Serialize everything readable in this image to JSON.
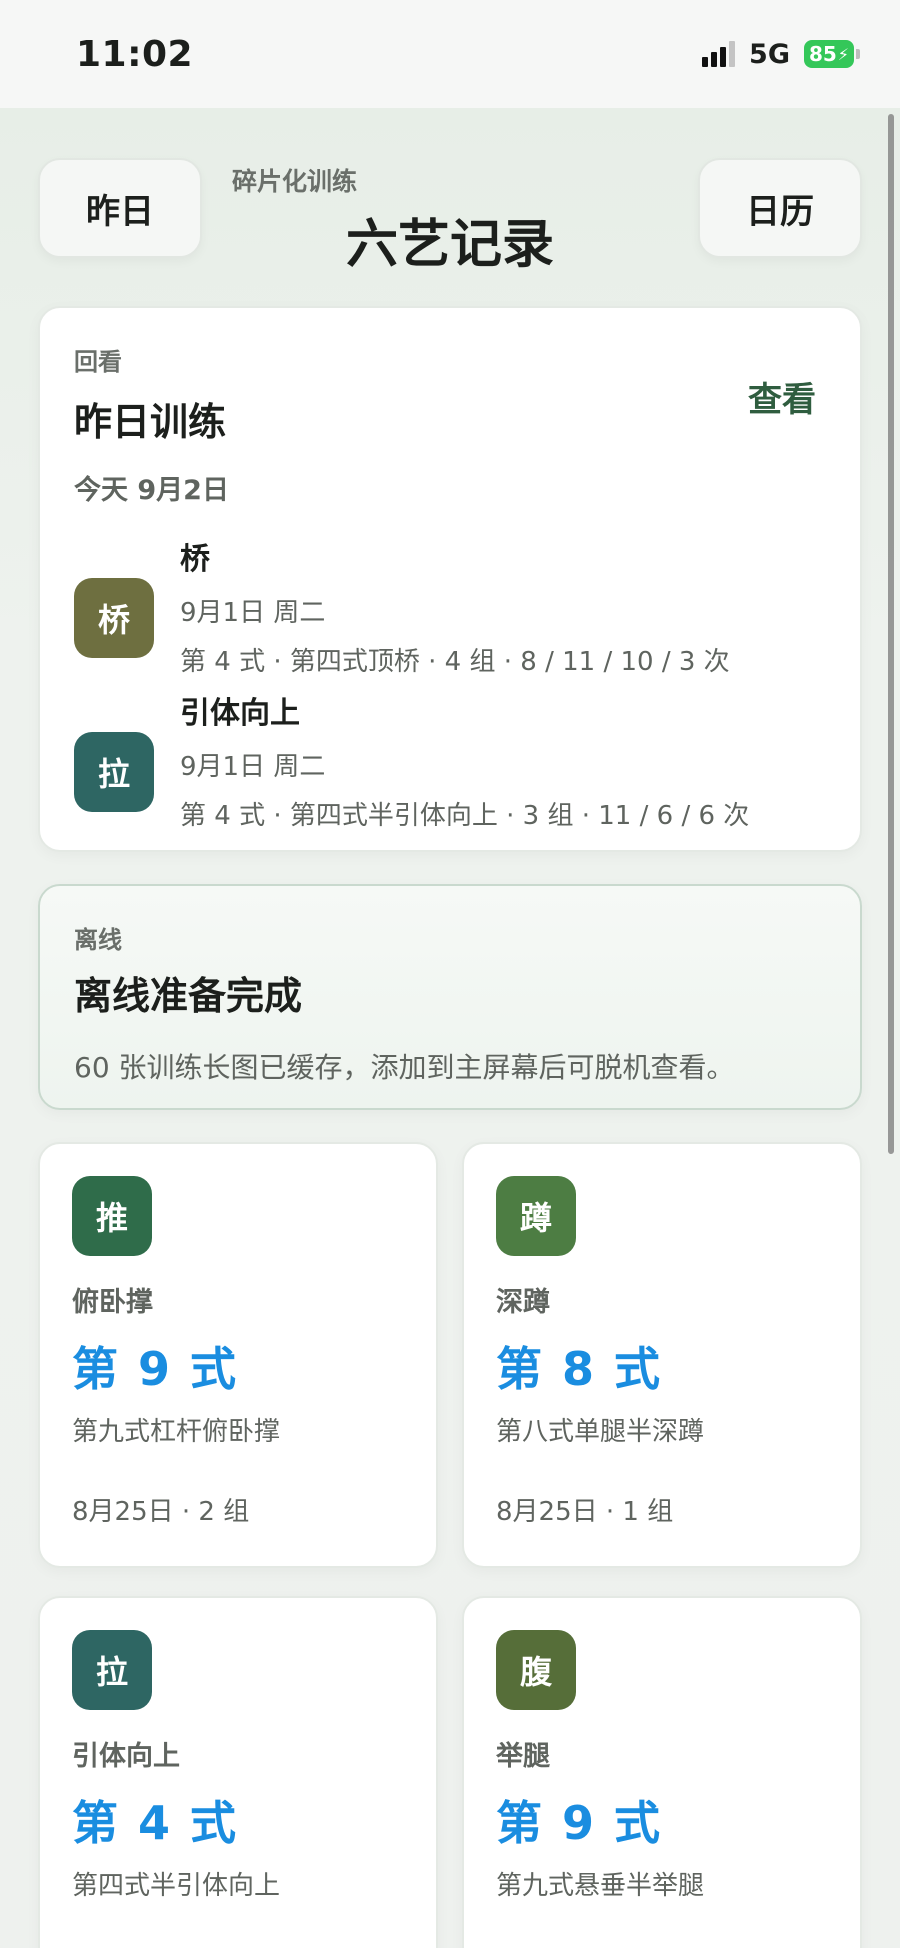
{
  "status_bar": {
    "time": "11:02",
    "network": "5G",
    "battery": "85"
  },
  "header": {
    "left_button": "昨日",
    "kicker": "碎片化训练",
    "title": "六艺记录",
    "right_button": "日历"
  },
  "review": {
    "kicker": "回看",
    "title": "昨日训练",
    "today": "今天 9月2日",
    "action": "查看",
    "entries": [
      {
        "badge": "桥",
        "color": "#6e6f40",
        "name": "桥",
        "date": "9月1日 周二",
        "detail": "第 4 式 · 第四式顶桥 · 4 组 · 8 / 11 / 10 / 3 次"
      },
      {
        "badge": "拉",
        "color": "#2e6663",
        "name": "引体向上",
        "date": "9月1日 周二",
        "detail": "第 4 式 · 第四式半引体向上 · 3 组 · 11 / 6 / 6 次"
      }
    ]
  },
  "offline": {
    "kicker": "离线",
    "title": "离线准备完成",
    "description": "60 张训练长图已缓存，添加到主屏幕后可脱机查看。"
  },
  "tiles": [
    {
      "badge": "推",
      "color": "#2f6c4a",
      "name": "俯卧撑",
      "level": "第 9 式",
      "desc": "第九式杠杆俯卧撑",
      "meta": "8月25日 · 2 组"
    },
    {
      "badge": "蹲",
      "color": "#4d7d43",
      "name": "深蹲",
      "level": "第 8 式",
      "desc": "第八式单腿半深蹲",
      "meta": "8月25日 · 1 组"
    },
    {
      "badge": "拉",
      "color": "#2e6663",
      "name": "引体向上",
      "level": "第 4 式",
      "desc": "第四式半引体向上",
      "meta": ""
    },
    {
      "badge": "腹",
      "color": "#566e39",
      "name": "举腿",
      "level": "第 9 式",
      "desc": "第九式悬垂半举腿",
      "meta": ""
    }
  ]
}
